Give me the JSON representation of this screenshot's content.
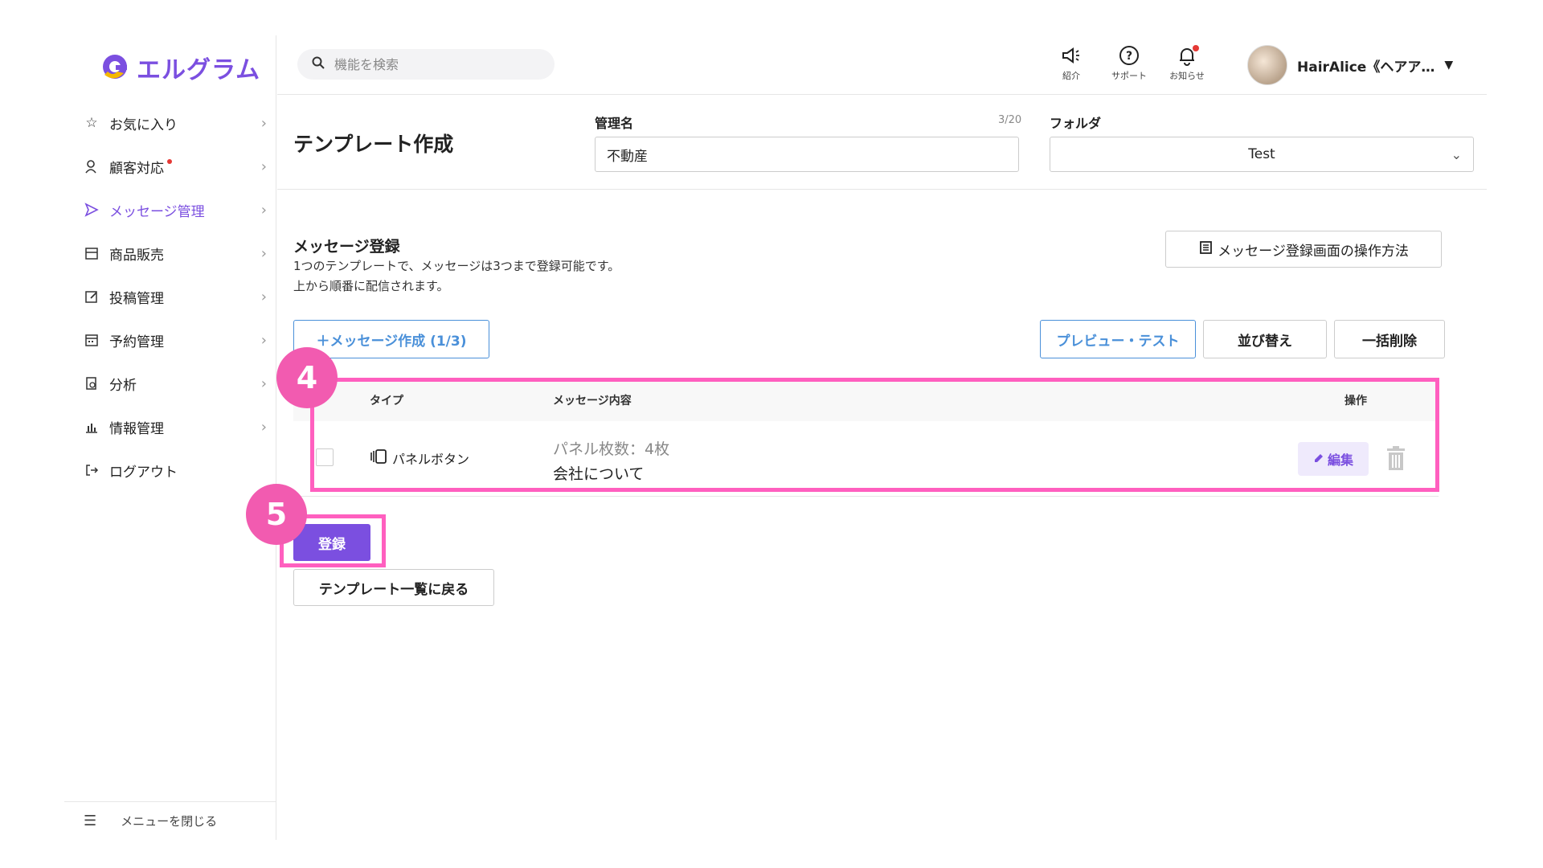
{
  "logo": {
    "text": "エルグラム",
    "color": "#7b4fe0"
  },
  "search": {
    "placeholder": "機能を検索"
  },
  "header": {
    "buttons": [
      {
        "label": "紹介",
        "icon": "megaphone-icon"
      },
      {
        "label": "サポート",
        "icon": "help-circle-icon"
      },
      {
        "label": "お知らせ",
        "icon": "bell-icon"
      }
    ],
    "user_name": "HairAlice《ヘアア…"
  },
  "sidebar": {
    "items": [
      {
        "label": "お気に入り",
        "icon": "star-icon"
      },
      {
        "label": "顧客対応",
        "icon": "user-icon",
        "dot": true
      },
      {
        "label": "メッセージ管理",
        "icon": "send-icon",
        "active": true
      },
      {
        "label": "商品販売",
        "icon": "store-icon"
      },
      {
        "label": "投稿管理",
        "icon": "edit-icon"
      },
      {
        "label": "予約管理",
        "icon": "calendar-icon"
      },
      {
        "label": "分析",
        "icon": "analysis-icon"
      },
      {
        "label": "情報管理",
        "icon": "bar-chart-icon"
      },
      {
        "label": "ログアウト",
        "icon": "logout-icon"
      }
    ],
    "close_menu": "メニューを閉じる"
  },
  "form": {
    "title": "テンプレート作成",
    "name_label": "管理名",
    "name_counter": "3/20",
    "name_value": "不動産",
    "folder_label": "フォルダ",
    "folder_value": "Test"
  },
  "messages": {
    "title": "メッセージ登録",
    "desc1": "1つのテンプレートで、メッセージは3つまで登録可能です。",
    "desc2": "上から順番に配信されます。",
    "howto_button": "メッセージ登録画面の操作方法",
    "create_button": "＋メッセージ作成 (1/3)",
    "preview_button": "プレビュー・テスト",
    "sort_button": "並び替え",
    "bulk_delete_button": "一括削除",
    "table": {
      "headers": {
        "type": "タイプ",
        "content": "メッセージ内容",
        "action": "操作"
      },
      "rows": [
        {
          "type": "パネルボタン",
          "sub": "パネル枚数：4枚",
          "main": "会社について",
          "edit": "編集"
        }
      ]
    },
    "submit_button": "登録",
    "back_button": "テンプレート一覧に戻る"
  },
  "annotations": {
    "badge4": "4",
    "badge5": "5",
    "color": "#ff5fbf"
  }
}
